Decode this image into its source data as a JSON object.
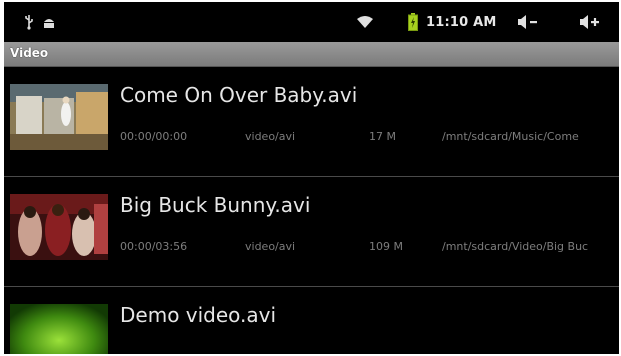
{
  "status_bar": {
    "time": "11:10 AM",
    "icons": [
      "usb-icon",
      "android-icon",
      "wifi-icon",
      "battery-charging-icon",
      "volume-down-icon",
      "volume-up-icon"
    ]
  },
  "section": {
    "title": "Video"
  },
  "videos": [
    {
      "title": "Come On Over Baby.avi",
      "duration": "00:00/00:00",
      "type": "video/avi",
      "size": "17 M",
      "path": "/mnt/sdcard/Music/Come"
    },
    {
      "title": "Big Buck Bunny.avi",
      "duration": "00:00/03:56",
      "type": "video/avi",
      "size": "109 M",
      "path": "/mnt/sdcard/Video/Big Buc"
    },
    {
      "title": "Demo video.avi"
    }
  ],
  "colors": {
    "background": "#000000",
    "header_bar": "#8a8a8a",
    "title_text": "#e6e6e6",
    "meta_text": "#7d7d7d",
    "battery": "#a6d11f"
  }
}
